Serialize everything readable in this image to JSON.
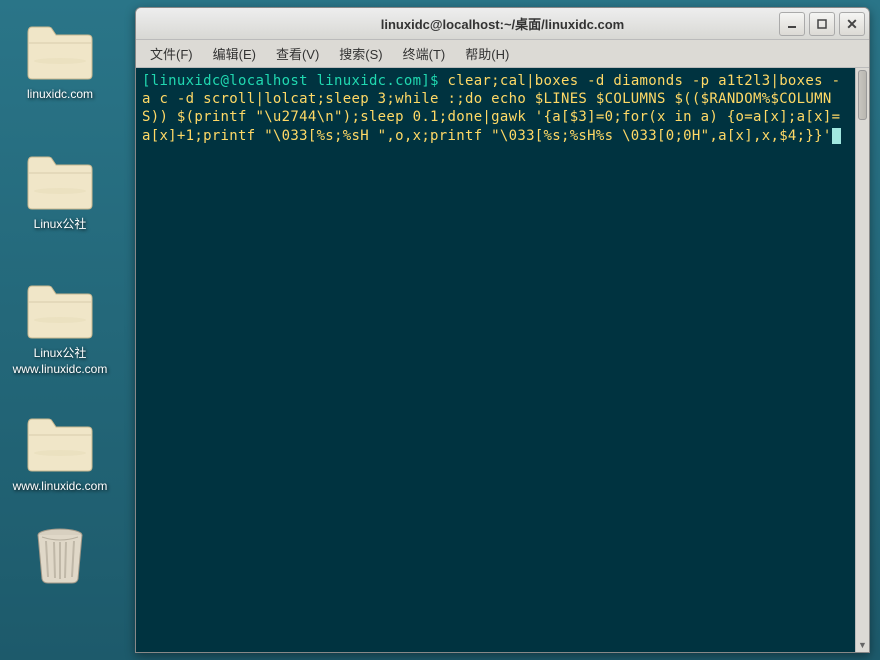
{
  "desktop_icons": [
    {
      "label": "linuxidc.com",
      "type": "folder"
    },
    {
      "label": "Linux公社",
      "type": "folder"
    },
    {
      "label": "Linux公社  www.linuxidc.com",
      "type": "folder"
    },
    {
      "label": "www.linuxidc.com",
      "type": "folder"
    },
    {
      "label": "",
      "type": "trash"
    }
  ],
  "window": {
    "title": "linuxidc@localhost:~/桌面/linuxidc.com"
  },
  "menubar": {
    "file": "文件(F)",
    "edit": "编辑(E)",
    "view": "查看(V)",
    "search": "搜索(S)",
    "terminal": "终端(T)",
    "help": "帮助(H)"
  },
  "terminal": {
    "prompt": "[linuxidc@localhost linuxidc.com]$ ",
    "command": "clear;cal|boxes -d diamonds -p a1t2l3|boxes -a c -d scroll|lolcat;sleep 3;while :;do echo $LINES $COLUMNS $(($RANDOM%$COLUMNS)) $(printf \"\\u2744\\n\");sleep 0.1;done|gawk '{a[$3]=0;for(x in a) {o=a[x];a[x]=a[x]+1;printf \"\\033[%s;%sH \",o,x;printf \"\\033[%s;%sH%s \\033[0;0H\",a[x],x,$4;}}'"
  },
  "colors": {
    "terminal_bg": "#003340",
    "prompt": "#20d8b0",
    "command": "#ffd966",
    "desktop_gradient_top": "#2a7588",
    "desktop_gradient_bottom": "#1d5a6b"
  }
}
